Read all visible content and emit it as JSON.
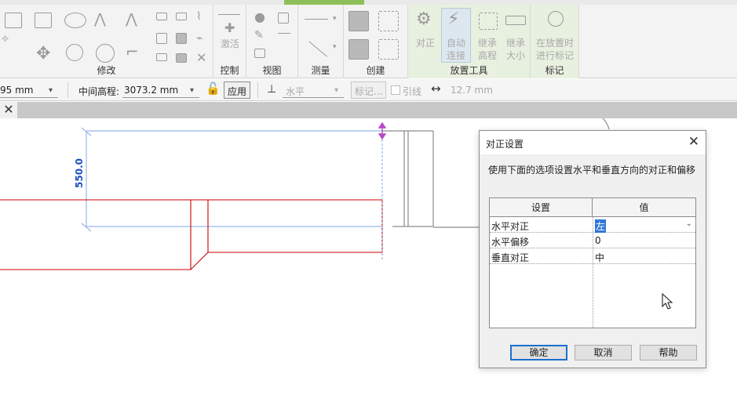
{
  "ribbon": {
    "panels": {
      "modify": "修改",
      "control": "控制",
      "view": "视图",
      "measure": "测量",
      "create": "创建",
      "placement_tools": "放置工具",
      "tag": "标记"
    },
    "tools": {
      "activate": "激活",
      "justify": "对正",
      "auto_connect": "自动\n连接",
      "inherit_elevation": "继承\n高程",
      "inherit_size": "继承\n大小",
      "tag_on_placement": "在放置时\n进行标记"
    }
  },
  "options_bar": {
    "partial_value": "95 mm",
    "middle_elevation_label": "中间高程:",
    "middle_elevation_value": "3073.2 mm",
    "apply_button": "应用",
    "horizontal_label": "水平",
    "tag_button": "标记...",
    "leader_label": "引线",
    "leader_length": "12.7 mm"
  },
  "canvas": {
    "dimension_text": "550.0"
  },
  "dialog": {
    "title": "对正设置",
    "description": "使用下面的选项设置水平和垂直方向的对正和偏移",
    "table": {
      "headers": [
        "设置",
        "值"
      ],
      "rows": [
        {
          "key": "水平对正",
          "value": "左"
        },
        {
          "key": "水平偏移",
          "value": "0"
        },
        {
          "key": "垂直对正",
          "value": "中"
        }
      ]
    },
    "buttons": {
      "ok": "确定",
      "cancel": "取消",
      "help": "帮助"
    }
  },
  "icons": [
    "lock-icon",
    "close-icon",
    "dropdown-icon",
    "mouse-cursor-icon",
    "align-icon",
    "width-icon"
  ],
  "colors": {
    "red_geometry": "#cc0000",
    "blue_dimension": "#1f4fbf",
    "selection_blue": "#2f78d4",
    "active_tab_green": "#8fbf5a"
  }
}
